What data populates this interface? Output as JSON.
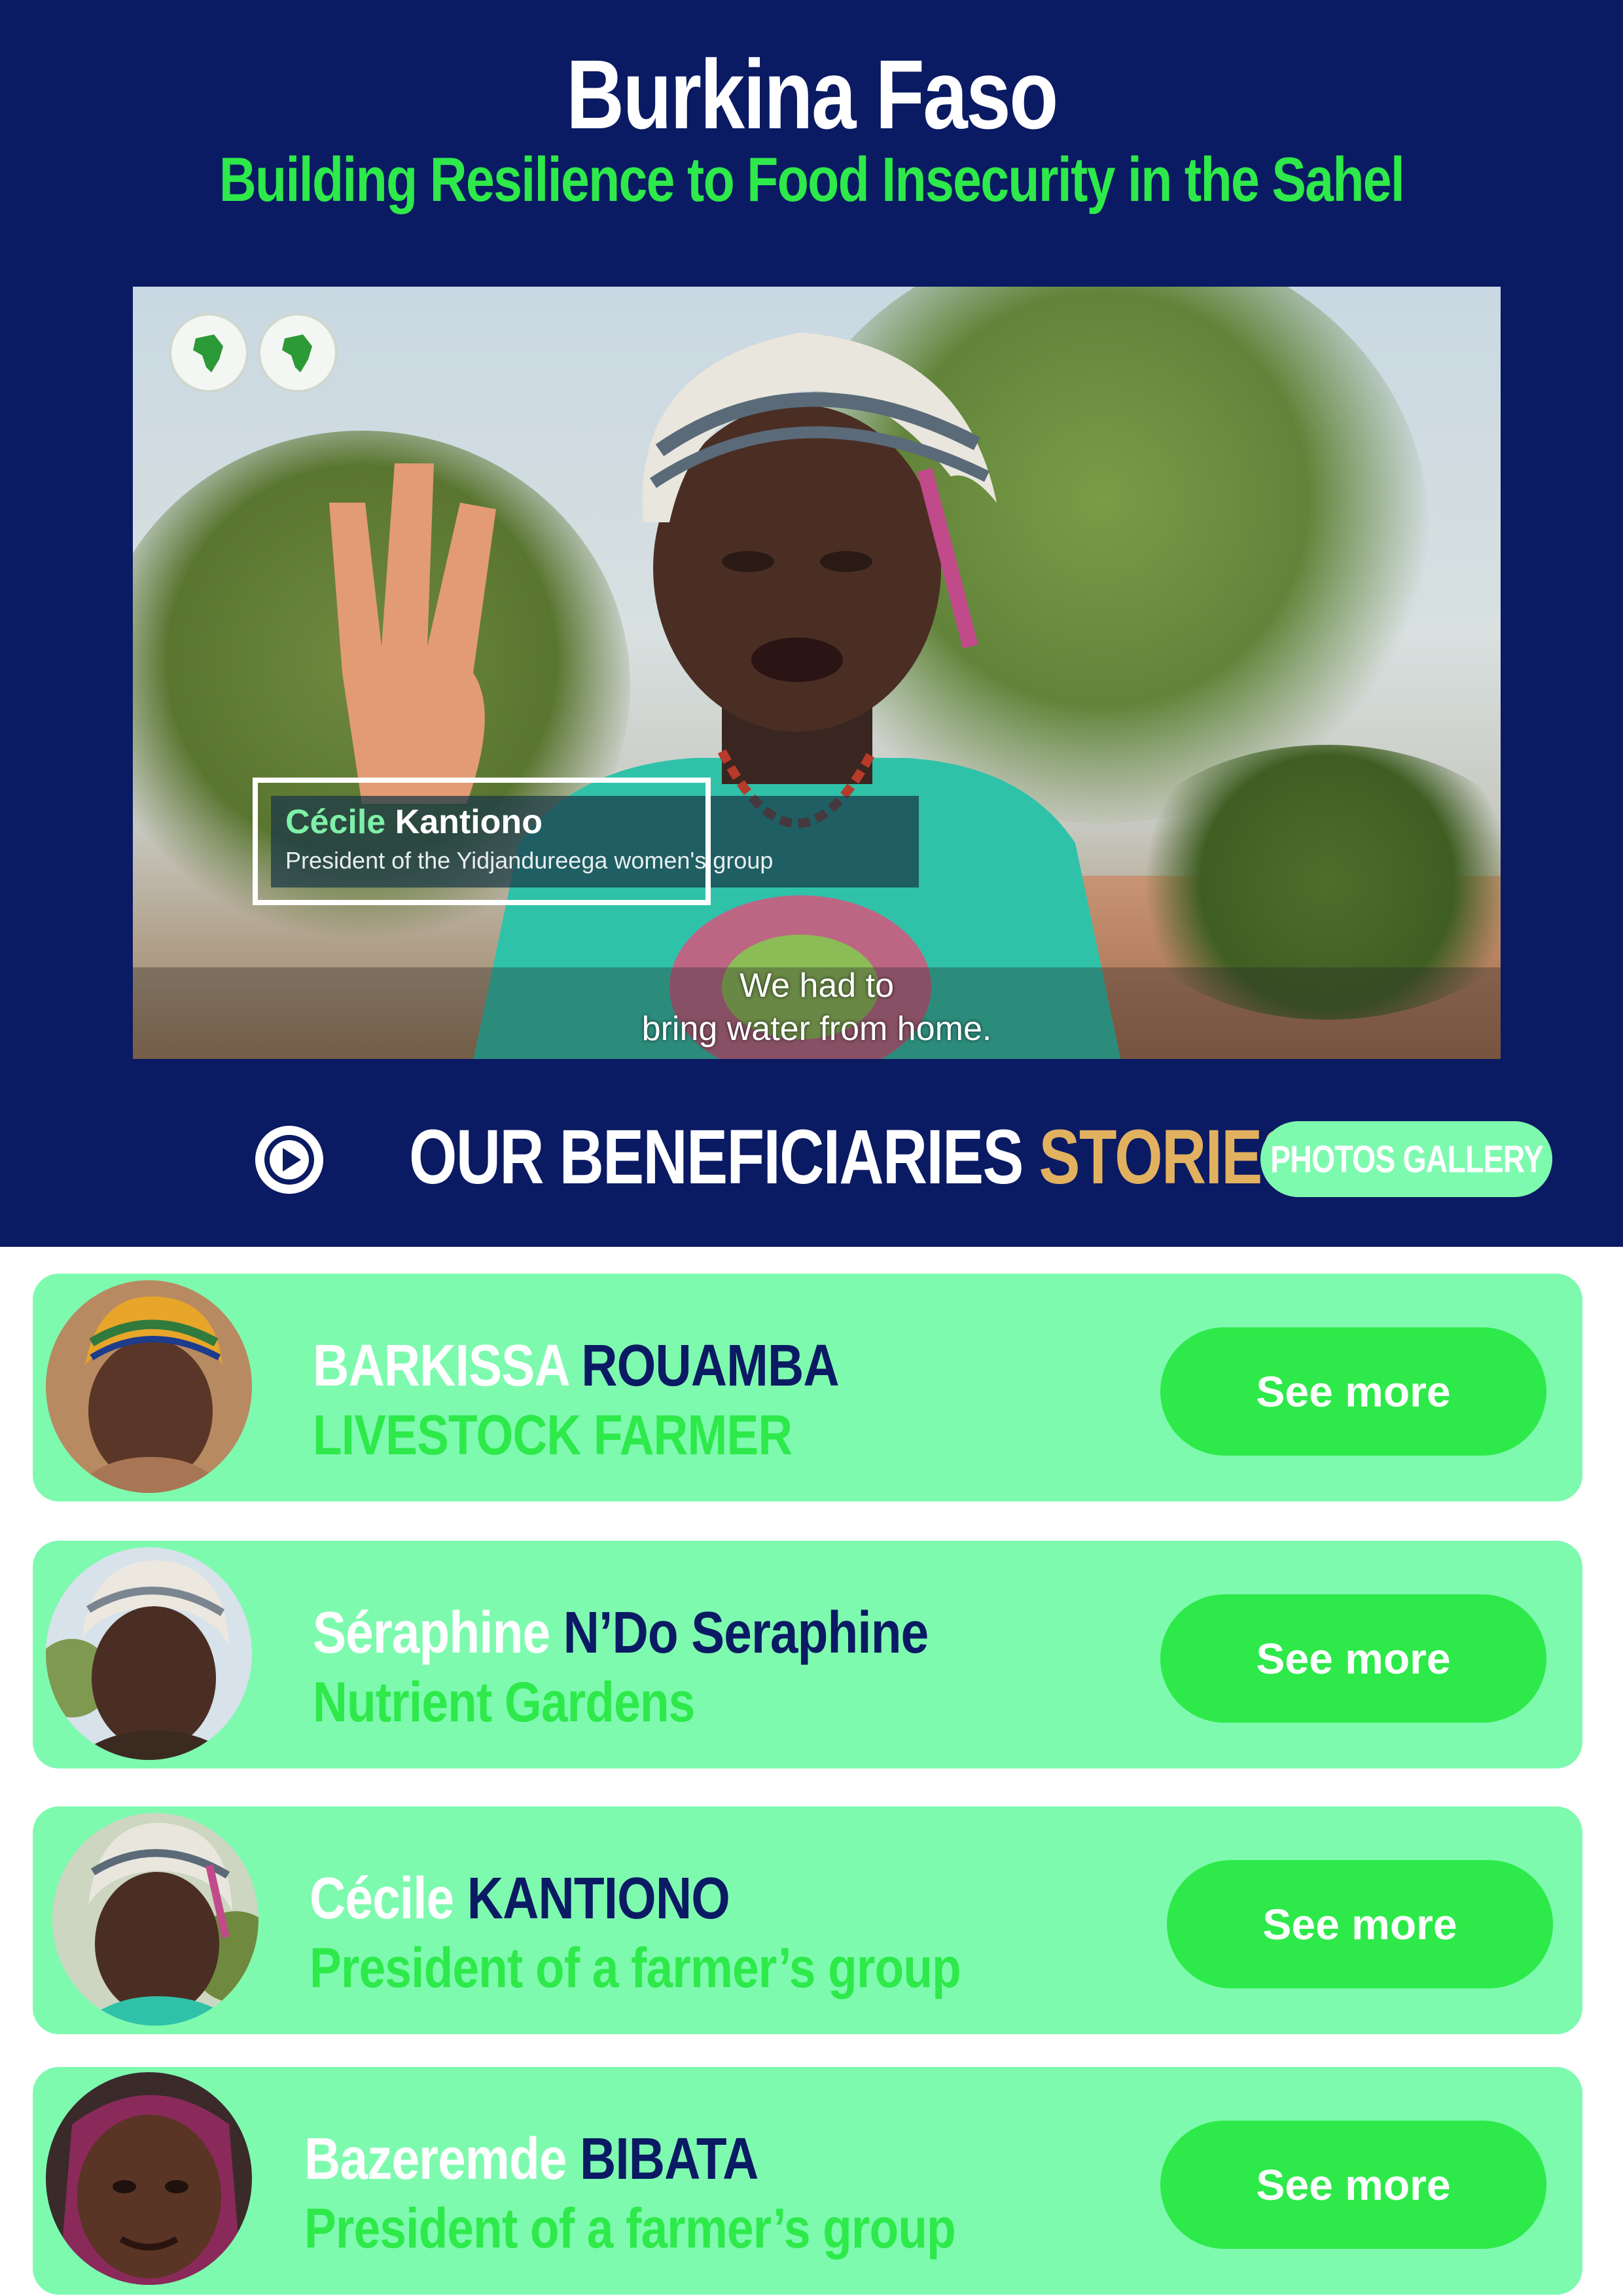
{
  "header": {
    "title": "Burkina Faso",
    "subtitle": "Building Resilience to Food Insecurity in the Sahel"
  },
  "video": {
    "overlay_name_first": "Cécile",
    "overlay_name_last": "Kantiono",
    "overlay_role": "President of the Yidjandureega women's group",
    "caption_line1": "We had to",
    "caption_line2": "bring water from home."
  },
  "section": {
    "title_main": "OUR BENEFICIARIES",
    "title_accent": "STORIES",
    "gallery_button": "PHOTOS GALLERY"
  },
  "colors": {
    "navy": "#0a1a63",
    "green": "#2ee94a",
    "mint": "#7efaaf",
    "gold": "#e2b15f"
  },
  "beneficiaries": [
    {
      "first": "BARKISSA",
      "last": "ROUAMBA",
      "role": "LIVESTOCK FARMER",
      "button": "See more"
    },
    {
      "first": "Séraphine",
      "last": "N’Do Seraphine",
      "role": "Nutrient Gardens",
      "button": "See more"
    },
    {
      "first": "Cécile",
      "last": "KANTIONO",
      "role": "President of a farmer’s group",
      "button": "See more"
    },
    {
      "first": "Bazeremde",
      "last": "BIBATA",
      "role": "President of a farmer’s group",
      "button": "See more"
    }
  ]
}
